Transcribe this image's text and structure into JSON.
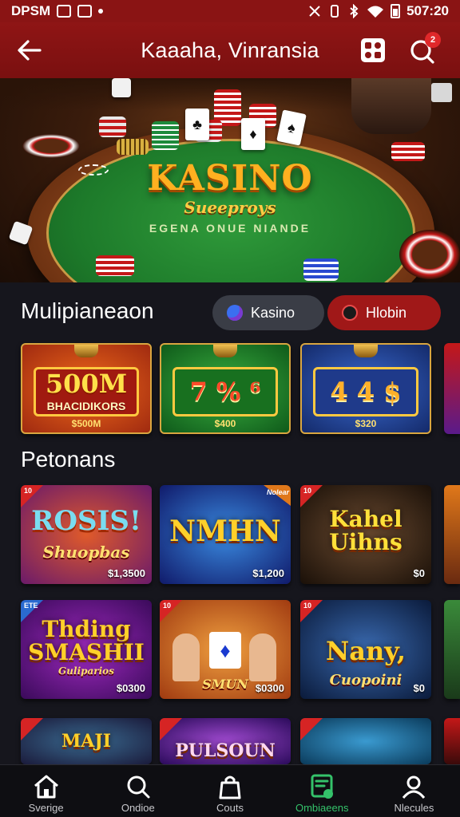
{
  "status_bar": {
    "left_text": "DPSM",
    "time": "507:20"
  },
  "header": {
    "title": "Kaaaha, Vinransia",
    "notification_count": "2"
  },
  "hero": {
    "title": "KASINO",
    "subtitle": "Sueeproys",
    "tagline": "EGENA ONUE NIANDE"
  },
  "section1": {
    "title": "Mulipianeaon",
    "filters": [
      {
        "label": "Kasino",
        "dot_color": "#3b6ff0"
      },
      {
        "label": "Hlobin",
        "dot_color": "#1a1a1a"
      }
    ],
    "slots": [
      {
        "main": "500M",
        "sub": "BHACIDIKORS",
        "bottom": "$500M",
        "bg": "#c4421a"
      },
      {
        "main": "7 % ⁶",
        "sub": "",
        "bottom": "$400",
        "bg": "#1d8a30"
      },
      {
        "main": "4 4 $",
        "sub": "",
        "bottom": "$320",
        "bg": "#2a4aa8"
      }
    ]
  },
  "section2": {
    "title": "Petonans",
    "games": [
      {
        "title": "ROSIS!",
        "sub": "Shuopbas",
        "price": "$1,3500",
        "corner": "10",
        "bg": "#7a2a8a"
      },
      {
        "title": "NMHN",
        "sub": "",
        "price": "$1,200",
        "corner": "Nolear",
        "bg": "#1a3aa0"
      },
      {
        "title": "Kahel Uihns",
        "sub": "",
        "price": "$0",
        "corner": "10",
        "bg": "#3a2418"
      },
      {
        "title": "Thding SMASHII",
        "sub": "Guliparios",
        "price": "$0300",
        "corner": "ETE",
        "bg": "#5a1a8a"
      },
      {
        "title": "",
        "sub": "SMUN",
        "price": "$0300",
        "corner": "10",
        "bg": "#c86a1a"
      },
      {
        "title": "Nany,",
        "sub": "Cuopoini",
        "price": "$0",
        "corner": "10",
        "bg": "#1a3a6a"
      }
    ],
    "row3_titles": [
      "MAJI",
      "PULSOUN",
      ""
    ]
  },
  "bottom_nav": [
    {
      "label": "Sverige",
      "icon": "home-icon"
    },
    {
      "label": "Ondioe",
      "icon": "search-icon"
    },
    {
      "label": "Couts",
      "icon": "bag-icon"
    },
    {
      "label": "Ombiaeens",
      "icon": "ticket-icon",
      "active": true
    },
    {
      "label": "Nlecules",
      "icon": "profile-icon"
    }
  ]
}
